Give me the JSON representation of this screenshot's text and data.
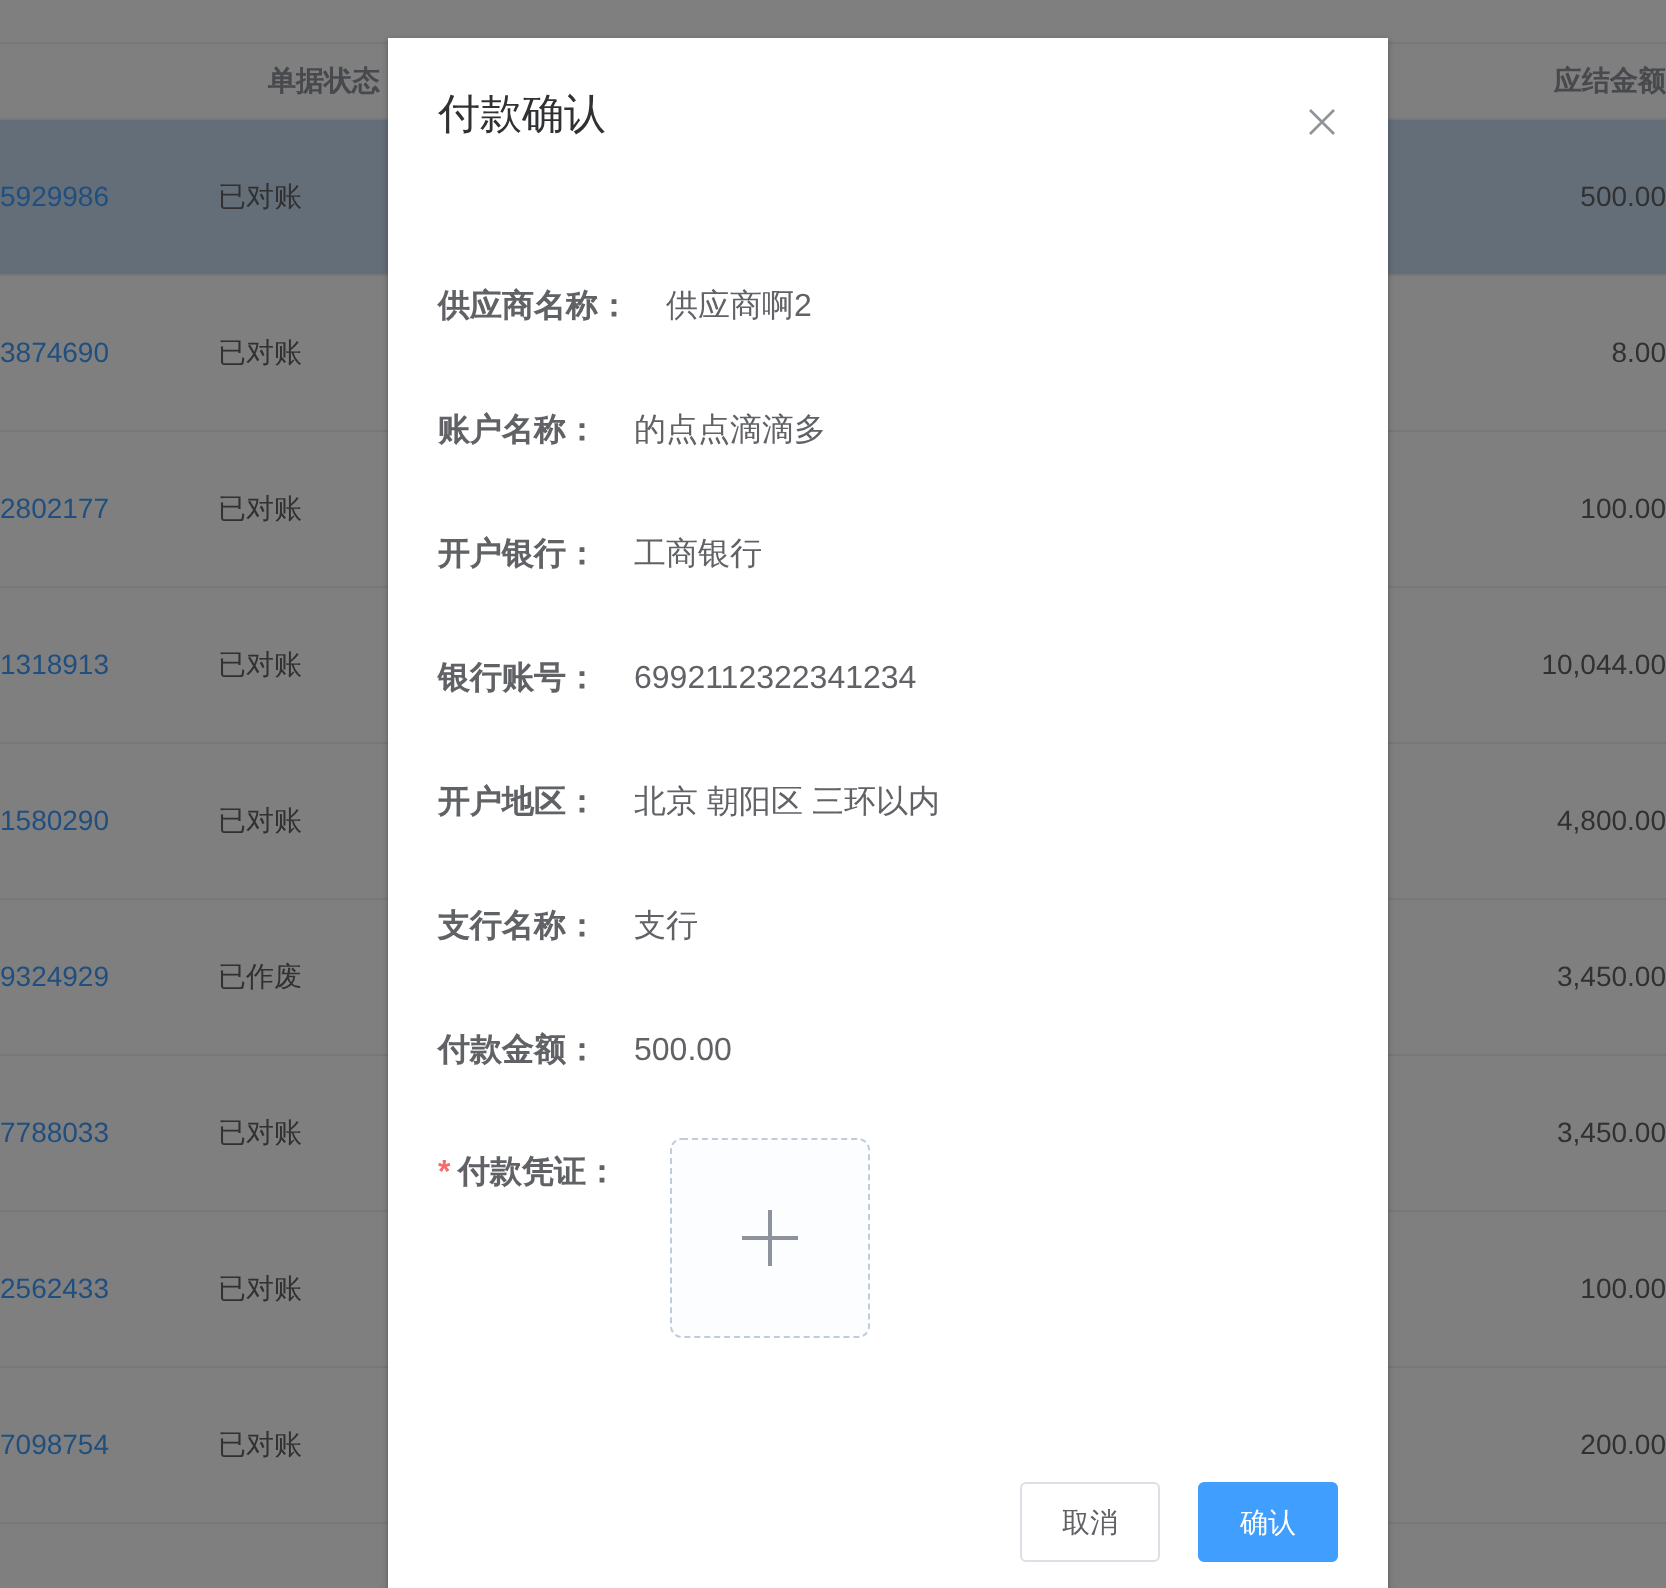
{
  "table": {
    "columns": [
      {
        "label": "单据状态"
      },
      {
        "label": "应结金额"
      }
    ],
    "rows": [
      {
        "column_1": "5929986",
        "status": "已对账",
        "amount": "500.00",
        "selected": true
      },
      {
        "column_1": "3874690",
        "status": "已对账",
        "amount": "8.00",
        "selected": false
      },
      {
        "column_1": "2802177",
        "status": "已对账",
        "amount": "100.00",
        "selected": false
      },
      {
        "column_1": "1318913",
        "status": "已对账",
        "amount": "10,044.00",
        "selected": false
      },
      {
        "column_1": "1580290",
        "status": "已对账",
        "amount": "4,800.00",
        "selected": false
      },
      {
        "column_1": "9324929",
        "status": "已作废",
        "amount": "3,450.00",
        "selected": false
      },
      {
        "column_1": "7788033",
        "status": "已对账",
        "amount": "3,450.00",
        "selected": false
      },
      {
        "column_1": "2562433",
        "status": "已对账",
        "amount": "100.00",
        "selected": false
      },
      {
        "column_1": "7098754",
        "status": "已对账",
        "amount": "200.00",
        "selected": false
      }
    ]
  },
  "dialog": {
    "title": "付款确认",
    "fields": [
      {
        "label": "供应商名称：",
        "value": "供应商啊2"
      },
      {
        "label": "账户名称：",
        "value": "的点点滴滴多"
      },
      {
        "label": "开户银行：",
        "value": "工商银行"
      },
      {
        "label": "银行账号：",
        "value": "6992112322341234"
      },
      {
        "label": "开户地区：",
        "value": "北京 朝阳区 三环以内"
      },
      {
        "label": "支行名称：",
        "value": "支行"
      },
      {
        "label": "付款金额：",
        "value": "500.00"
      }
    ],
    "upload": {
      "label": "付款凭证：",
      "required_mark": "*"
    },
    "buttons": [
      {
        "label": "取消",
        "kind": "default"
      },
      {
        "label": "确认",
        "kind": "primary"
      }
    ]
  }
}
